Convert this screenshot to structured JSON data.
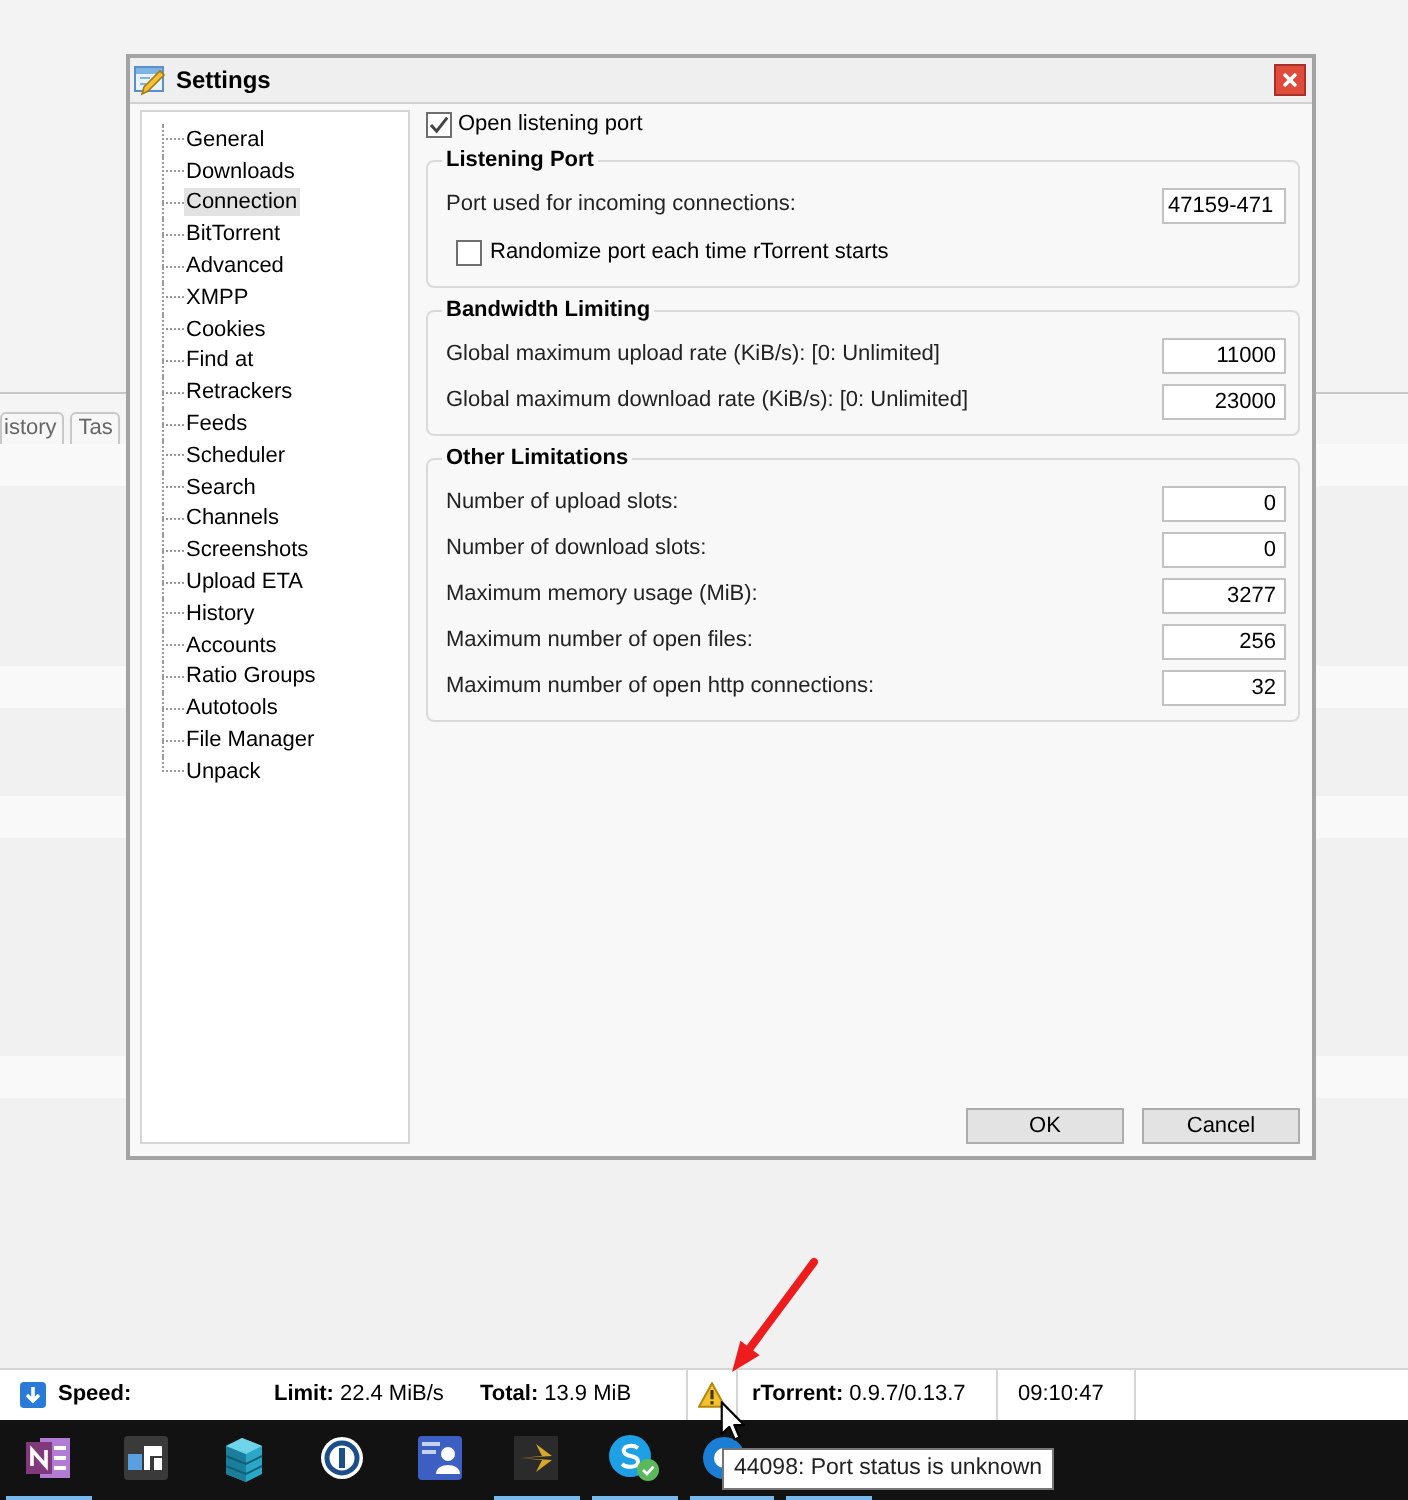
{
  "background": {
    "tabs": [
      {
        "label": "istory"
      },
      {
        "label": "Tas"
      }
    ]
  },
  "dialog": {
    "title": "Settings",
    "nav": [
      {
        "label": "General",
        "selected": false
      },
      {
        "label": "Downloads",
        "selected": false
      },
      {
        "label": "Connection",
        "selected": true
      },
      {
        "label": "BitTorrent",
        "selected": false
      },
      {
        "label": "Advanced",
        "selected": false
      },
      {
        "label": "XMPP",
        "selected": false
      },
      {
        "label": "Cookies",
        "selected": false
      },
      {
        "label": "Find at",
        "selected": false
      },
      {
        "label": "Retrackers",
        "selected": false
      },
      {
        "label": "Feeds",
        "selected": false
      },
      {
        "label": "Scheduler",
        "selected": false
      },
      {
        "label": "Search",
        "selected": false
      },
      {
        "label": "Channels",
        "selected": false
      },
      {
        "label": "Screenshots",
        "selected": false
      },
      {
        "label": "Upload ETA",
        "selected": false
      },
      {
        "label": "History",
        "selected": false
      },
      {
        "label": "Accounts",
        "selected": false
      },
      {
        "label": "Ratio Groups",
        "selected": false
      },
      {
        "label": "Autotools",
        "selected": false
      },
      {
        "label": "File Manager",
        "selected": false
      },
      {
        "label": "Unpack",
        "selected": false
      }
    ],
    "open_port": {
      "label": "Open listening port",
      "checked": true
    },
    "groups": [
      {
        "title": "Listening Port",
        "rows": [
          {
            "kind": "text",
            "label": "Port used for incoming connections:",
            "value": "47159-471"
          },
          {
            "kind": "checkbox",
            "label": "Randomize port each time rTorrent starts",
            "checked": false
          }
        ]
      },
      {
        "title": "Bandwidth Limiting",
        "rows": [
          {
            "kind": "number",
            "label": "Global maximum upload rate (KiB/s): [0: Unlimited]",
            "value": "11000"
          },
          {
            "kind": "number",
            "label": "Global maximum download rate (KiB/s): [0: Unlimited]",
            "value": "23000"
          }
        ]
      },
      {
        "title": "Other Limitations",
        "rows": [
          {
            "kind": "number",
            "label": "Number of upload slots:",
            "value": "0"
          },
          {
            "kind": "number",
            "label": "Number of download slots:",
            "value": "0"
          },
          {
            "kind": "number",
            "label": "Maximum memory usage (MiB):",
            "value": "3277"
          },
          {
            "kind": "number",
            "label": "Maximum number of open files:",
            "value": "256"
          },
          {
            "kind": "number",
            "label": "Maximum number of open http connections:",
            "value": "32"
          }
        ]
      }
    ],
    "buttons": [
      {
        "label": "OK"
      },
      {
        "label": "Cancel"
      }
    ]
  },
  "status_bar": {
    "speed": {
      "label": "Speed:"
    },
    "limit": {
      "label": "Limit:",
      "value": "22.4 MiB/s"
    },
    "total": {
      "label": "Total:",
      "value": "13.9 MiB"
    },
    "version": {
      "label": "rTorrent:",
      "value": "0.9.7/0.13.7"
    },
    "time": "09:10:47"
  },
  "taskbar": [
    {
      "running": true
    },
    {
      "running": false
    },
    {
      "running": false
    },
    {
      "running": false
    },
    {
      "running": false
    },
    {
      "running": true
    },
    {
      "running": true
    },
    {
      "running": true
    },
    {
      "running": true
    }
  ],
  "tooltip": "44098: Port status is unknown"
}
